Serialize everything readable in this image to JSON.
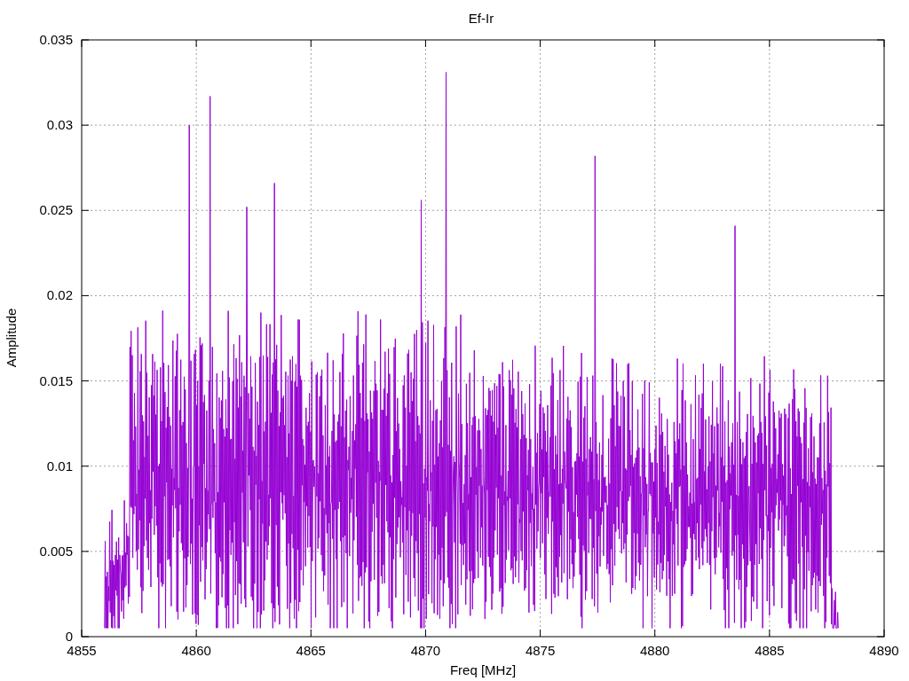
{
  "chart": {
    "title": "Ef-Ir",
    "xlabel": "Freq [MHz]",
    "ylabel": "Amplitude",
    "xticks": [
      "4855",
      "4860",
      "4865",
      "4870",
      "4875",
      "4880",
      "4885",
      "4890"
    ],
    "yticks": [
      "0.035",
      "0.03",
      "0.025",
      "0.02",
      "0.015",
      "0.01",
      "0.005",
      "0"
    ]
  }
}
